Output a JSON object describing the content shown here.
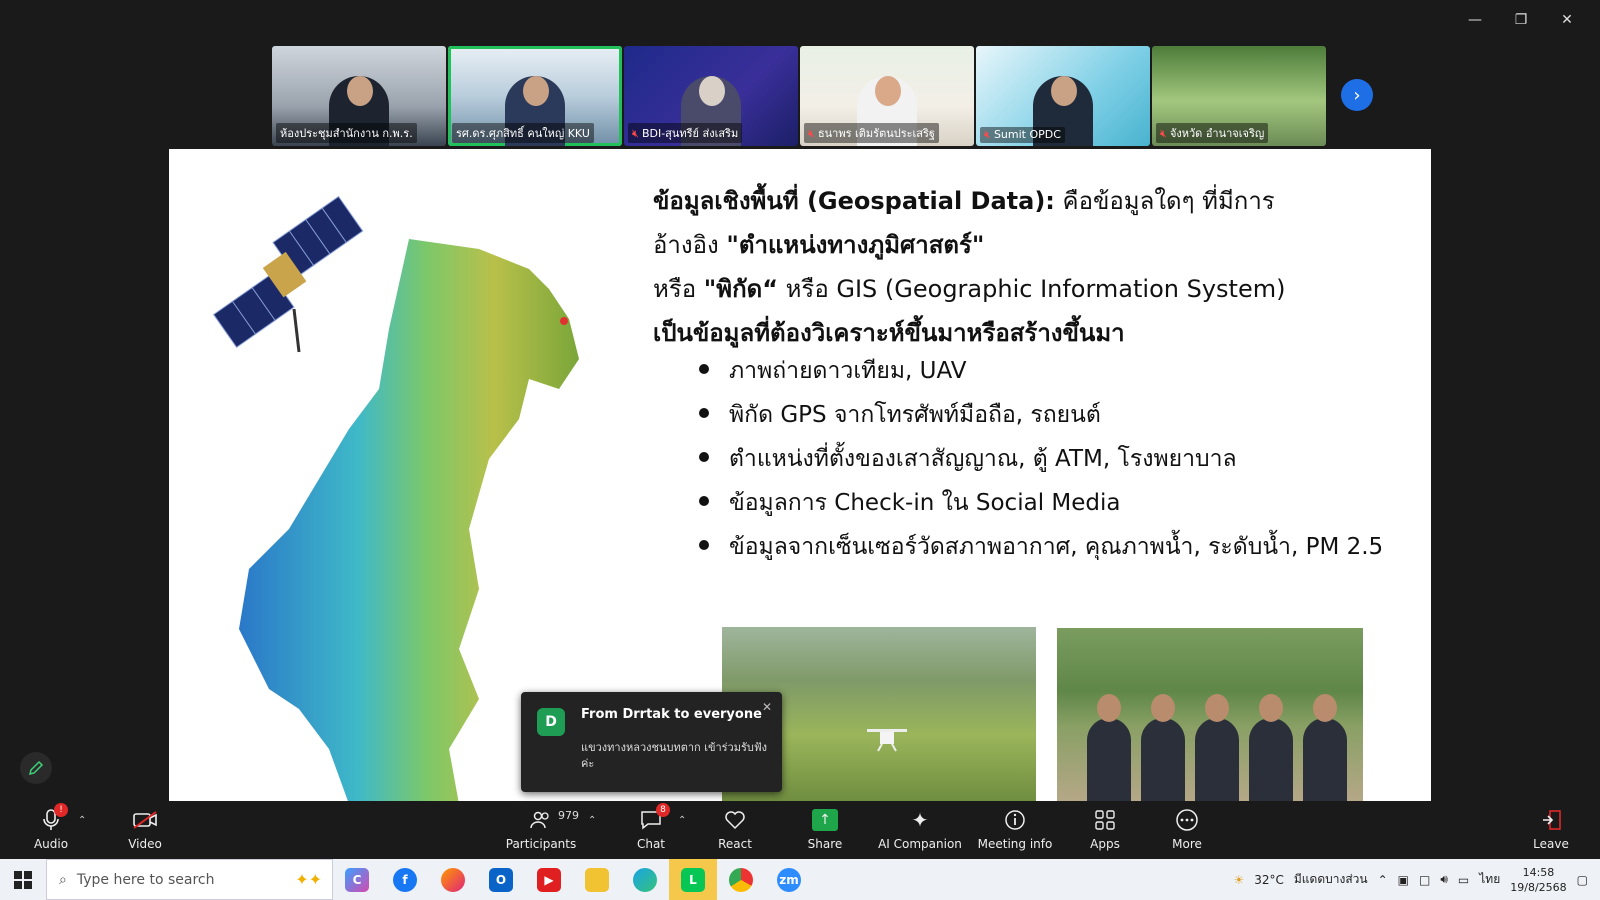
{
  "window": {
    "controls": [
      "minimize-icon",
      "restore-icon",
      "close-icon"
    ]
  },
  "participants_strip": [
    {
      "name": "ห้องประชุมสำนักงาน ก.พ.ร.",
      "muted": false
    },
    {
      "name": "รศ.ดร.ศุภสิทธิ์ คนใหญ่ KKU",
      "muted": false,
      "active": true
    },
    {
      "name": "BDI-สุนทรีย์ ส่งเสริม",
      "muted": true
    },
    {
      "name": "ธนาพร เติมรัตนประเสริฐ",
      "muted": true
    },
    {
      "name": "Sumit OPDC",
      "muted": true
    },
    {
      "name": "จังหวัด อำนาจเจริญ",
      "muted": true
    }
  ],
  "slide": {
    "title_bold_1": "ข้อมูลเชิงพื้นที่ (Geospatial Data):",
    "title_rest_1": " คือข้อมูลใดๆ ที่มีการ",
    "line2_plain": "อ้างอิง ",
    "line2_bold": "\"ตำแหน่งทางภูมิศาสตร์\"",
    "line3_plain_a": "หรือ ",
    "line3_bold": "\"พิกัด“",
    "line3_plain_b": " หรือ GIS (Geographic Information System)",
    "line4_bold": "เป็นข้อมูลที่ต้องวิเคราะห์ขึ้นมาหรือสร้างขึ้นมา",
    "bullets": [
      "ภาพถ่ายดาวเทียม, UAV",
      "พิกัด GPS จากโทรศัพท์มือถือ, รถยนต์",
      "ตำแหน่งที่ตั้งของเสาสัญญาณ, ตู้ ATM, โรงพยาบาล",
      "ข้อมูลการ Check-in ใน Social Media",
      "ข้อมูลจากเซ็นเซอร์วัดสภาพอากาศ, คุณภาพน้ำ, ระดับน้ำ, PM 2.5"
    ]
  },
  "chat_popup": {
    "avatar": "D",
    "from": "From Drrtak to everyone",
    "message": "แขวงทางหลวงชนบทตาก เข้าร่วมรับฟังค่ะ"
  },
  "toolbar": {
    "audio": "Audio",
    "video": "Video",
    "participants": "Participants",
    "participants_count": "979",
    "chat": "Chat",
    "chat_badge": "8",
    "react": "React",
    "share": "Share",
    "ai": "AI Companion",
    "meeting_info": "Meeting info",
    "apps": "Apps",
    "more": "More",
    "leave": "Leave"
  },
  "taskbar": {
    "search_placeholder": "Type here to search",
    "weather": "32°C",
    "weather_text": "มีแดดบางส่วน",
    "lang": "ไทย",
    "time": "14:58",
    "date": "19/8/2568"
  }
}
